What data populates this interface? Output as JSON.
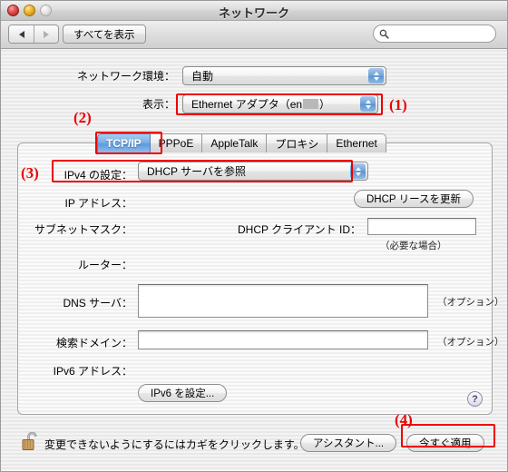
{
  "window": {
    "title": "ネットワーク",
    "traffic_lights": [
      "close-button",
      "minimize-button",
      "zoom-button"
    ]
  },
  "toolbar": {
    "back_icon": "triangle-left-icon",
    "forward_icon": "triangle-right-icon",
    "show_all_label": "すべてを表示",
    "search": {
      "icon": "search-icon",
      "value": "",
      "placeholder": ""
    }
  },
  "top_form": {
    "location": {
      "label": "ネットワーク環境：",
      "value": "自動"
    },
    "show": {
      "label": "表示：",
      "value_prefix": "Ethernet アダプタ（en",
      "value_redacted": true,
      "value_suffix": "）"
    }
  },
  "tabs": [
    {
      "label": "TCP/IP",
      "active": true
    },
    {
      "label": "PPPoE",
      "active": false
    },
    {
      "label": "AppleTalk",
      "active": false
    },
    {
      "label": "プロキシ",
      "active": false
    },
    {
      "label": "Ethernet",
      "active": false
    }
  ],
  "panel": {
    "ipv4_config": {
      "label": "IPv4 の設定：",
      "value": "DHCP サーバを参照"
    },
    "ip_address": {
      "label": "IP アドレス：",
      "value": ""
    },
    "subnet_mask": {
      "label": "サブネットマスク：",
      "value": ""
    },
    "router": {
      "label": "ルーター：",
      "value": ""
    },
    "dhcp_renew_button": "DHCP リースを更新",
    "dhcp_client_id": {
      "label": "DHCP クライアント ID：",
      "value": "",
      "hint": "（必要な場合）"
    },
    "dns_servers": {
      "label": "DNS サーバ：",
      "value": "",
      "hint": "（オプション）"
    },
    "search_domains": {
      "label": "検索ドメイン：",
      "value": "",
      "hint": "（オプション）"
    },
    "ipv6_address": {
      "label": "IPv6 アドレス：",
      "value": ""
    },
    "ipv6_config_button": "IPv6 を設定...",
    "help_button": "?"
  },
  "footer": {
    "lock_icon": "unlocked-padlock-icon",
    "lock_text": "変更できないようにするにはカギをクリックします。",
    "assistant_button": "アシスタント...",
    "apply_button": "今すぐ適用"
  },
  "annotations": {
    "marker1": "(1)",
    "marker2": "(2)",
    "marker3": "(3)",
    "marker4": "(4)",
    "color": "#ee0000"
  }
}
